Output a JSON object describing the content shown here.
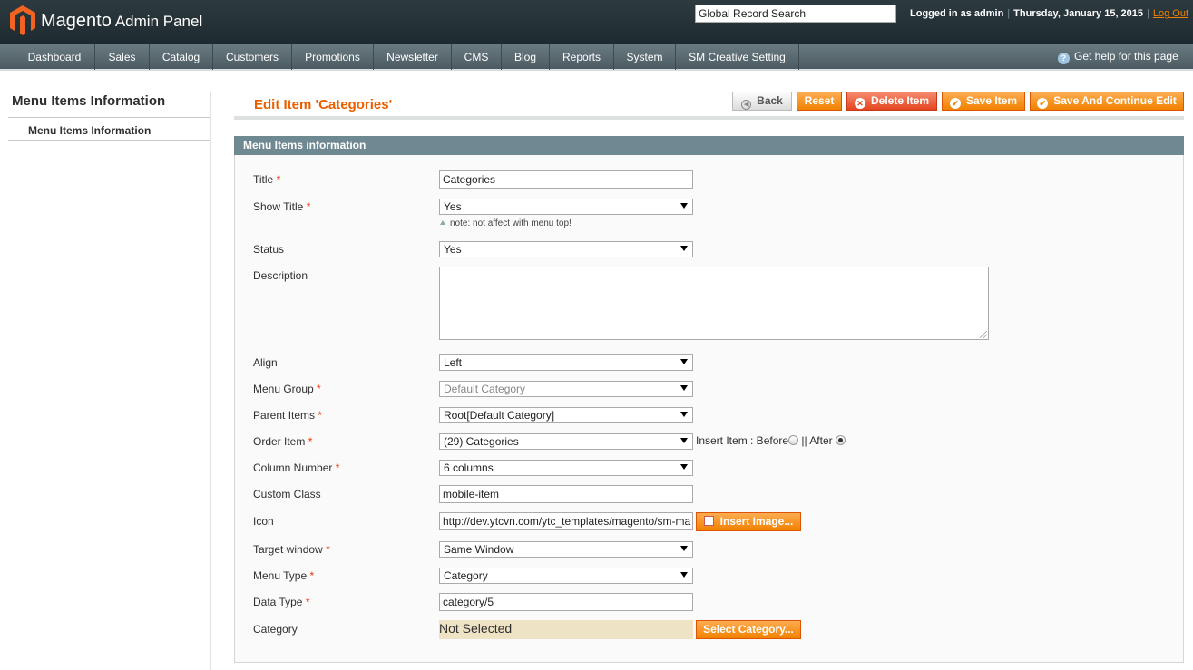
{
  "header": {
    "logo_brand": "Magento",
    "logo_sub": "Admin Panel",
    "search_value": "Global Record Search",
    "logged_in": "Logged in as admin",
    "date": "Thursday, January 15, 2015",
    "logout": "Log Out",
    "accent_color": "#f18200"
  },
  "nav": {
    "items": [
      "Dashboard",
      "Sales",
      "Catalog",
      "Customers",
      "Promotions",
      "Newsletter",
      "CMS",
      "Blog",
      "Reports",
      "System",
      "SM Creative Setting"
    ],
    "help": "Get help for this page",
    "help_icon": "help-icon"
  },
  "sidebar": {
    "title": "Menu Items Information",
    "tab": "Menu Items Information"
  },
  "content": {
    "title": "Edit Item 'Categories'",
    "buttons": {
      "back": "Back",
      "reset": "Reset",
      "delete": "Delete Item",
      "save": "Save Item",
      "save_continue": "Save And Continue Edit"
    }
  },
  "form": {
    "section": "Menu Items information",
    "title_label": "Title",
    "title_value": "Categories",
    "show_title_label": "Show Title",
    "show_title_value": "Yes",
    "show_title_note": "note: not affect with menu top!",
    "status_label": "Status",
    "status_value": "Yes",
    "description_label": "Description",
    "align_label": "Align",
    "align_value": "Left",
    "menu_group_label": "Menu Group",
    "menu_group_value": "Default Category",
    "parent_label": "Parent Items",
    "parent_value": "Root[Default Category]",
    "order_label": "Order Item",
    "order_value": "(29) Categories",
    "insert_label": "Insert Item : Before",
    "insert_after": "|| After",
    "insert_selected": "After",
    "column_label": "Column Number",
    "column_value": "6 columns",
    "custom_class_label": "Custom Class",
    "custom_class_value": "mobile-item",
    "icon_label": "Icon",
    "icon_value": "http://dev.ytcvn.com/ytc_templates/magento/sm-ma",
    "insert_image": "Insert Image...",
    "target_label": "Target window",
    "target_value": "Same Window",
    "menu_type_label": "Menu Type",
    "menu_type_value": "Category",
    "data_type_label": "Data Type",
    "data_type_value": "category/5",
    "category_label": "Category",
    "category_value": "Not Selected",
    "select_category": "Select Category..."
  }
}
